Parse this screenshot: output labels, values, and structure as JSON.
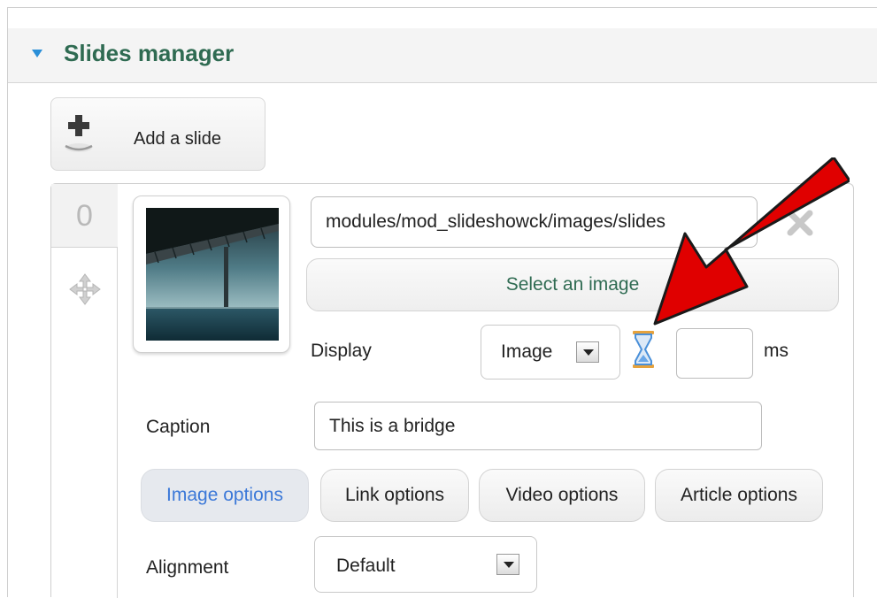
{
  "panel": {
    "title": "Slides manager"
  },
  "toolbar": {
    "add_slide_label": "Add a slide"
  },
  "slide": {
    "index": "0",
    "image_path": "modules/mod_slideshowck/images/slides",
    "select_image_label": "Select an image",
    "display_label": "Display",
    "display_value": "Image",
    "duration_value": "",
    "duration_unit": "ms",
    "caption_label": "Caption",
    "caption_value": "This is a bridge",
    "tabs": [
      {
        "label": "Image options",
        "active": true
      },
      {
        "label": "Link options",
        "active": false
      },
      {
        "label": "Video options",
        "active": false
      },
      {
        "label": "Article options",
        "active": false
      }
    ],
    "alignment_label": "Alignment",
    "alignment_value": "Default"
  },
  "colors": {
    "title_green": "#2f6b52",
    "accent_blue": "#3b78d8",
    "toggle_blue": "#2a8fd8",
    "annotation_red": "#e00000"
  },
  "icons": [
    "chevron-down-icon",
    "plus-icon",
    "move-icon",
    "remove-icon",
    "hourglass-icon",
    "annotation-arrow"
  ]
}
